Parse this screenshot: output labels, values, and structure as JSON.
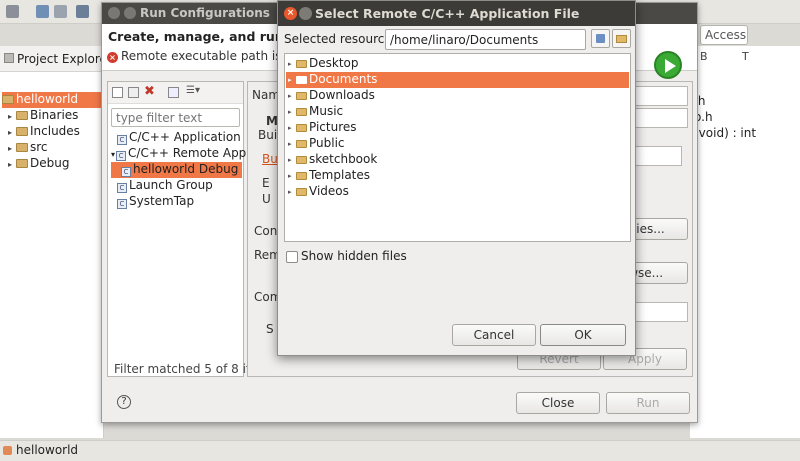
{
  "workbench": {
    "access_label": "Access",
    "status": "helloworld",
    "project_explorer": {
      "title": "Project Explorer",
      "items": [
        {
          "label": "helloworld",
          "selected": true
        },
        {
          "label": "Binaries"
        },
        {
          "label": "Includes"
        },
        {
          "label": "src"
        },
        {
          "label": "Debug"
        }
      ]
    },
    "editor_fragments": [
      ".h",
      "o.h",
      "(void) : int"
    ],
    "editor_toolbar": [
      "B",
      "T"
    ]
  },
  "run_config": {
    "title": "Run Configurations",
    "heading": "Create, manage, and run co",
    "error": "Remote executable path is no",
    "filter_placeholder": "type filter text",
    "tree": [
      {
        "label": "C/C++ Application",
        "indent": 0,
        "icon": "c-app-icon"
      },
      {
        "label": "C/C++ Remote Applica",
        "indent": 0,
        "icon": "c-remote-icon",
        "expanded": true
      },
      {
        "label": "helloworld Debug",
        "indent": 1,
        "icon": "c-app-icon",
        "selected": true
      },
      {
        "label": "Launch Group",
        "indent": 0,
        "icon": "launch-group-icon"
      },
      {
        "label": "SystemTap",
        "indent": 0,
        "icon": "systemtap-icon"
      }
    ],
    "filter_status": "Filter matched 5 of 8 item",
    "right_fragments": {
      "name_label": "Nam",
      "main_tab": "Ma",
      "build_label": "Buil",
      "build_link": "Bui",
      "radio1": "E",
      "radio2": "U",
      "conn_label": "Con",
      "remote_label": "Rem",
      "cmd_label": "Com",
      "skip_label": "S",
      "properties_btn": "erties...",
      "browse_btn": "owse..."
    },
    "buttons": {
      "revert": "Revert",
      "apply": "Apply",
      "close": "Close",
      "run": "Run"
    }
  },
  "remote_dialog": {
    "title": "Select Remote C/C++ Application File",
    "selected_resource_label": "Selected resource:",
    "selected_resource_value": "/home/linaro/Documents",
    "folders": [
      {
        "label": "Desktop"
      },
      {
        "label": "Documents",
        "selected": true
      },
      {
        "label": "Downloads"
      },
      {
        "label": "Music"
      },
      {
        "label": "Pictures"
      },
      {
        "label": "Public"
      },
      {
        "label": "sketchbook"
      },
      {
        "label": "Templates"
      },
      {
        "label": "Videos"
      }
    ],
    "show_hidden_label": "Show hidden files",
    "cancel_label": "Cancel",
    "ok_label": "OK"
  }
}
